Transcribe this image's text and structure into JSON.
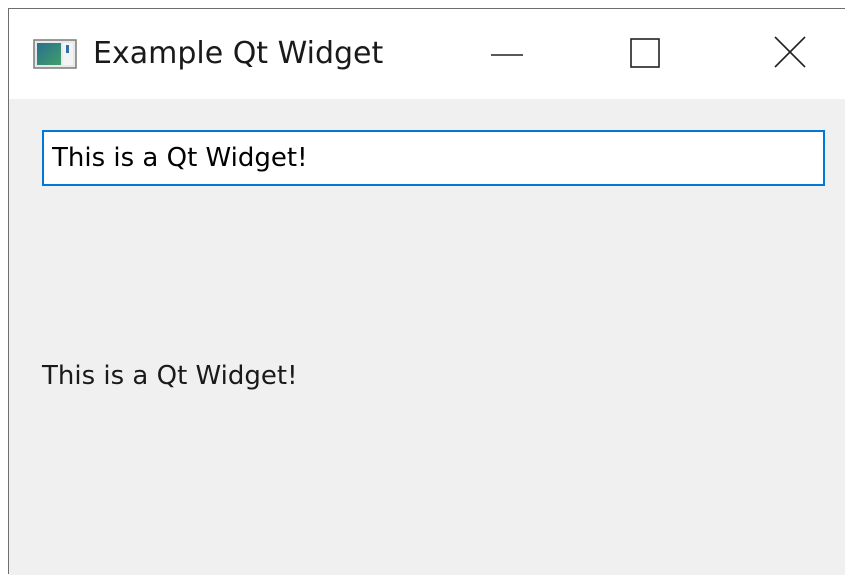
{
  "window": {
    "title": "Example Qt Widget",
    "app_icon": "qt-window-icon",
    "controls": {
      "minimize_icon": "minimize-icon",
      "maximize_icon": "maximize-icon",
      "close_icon": "close-icon"
    }
  },
  "content": {
    "line_edit": {
      "value": "This is a Qt Widget!",
      "focused": true
    },
    "label": {
      "text": "This is a Qt Widget!"
    }
  },
  "colors": {
    "focus_border": "#0078d7",
    "window_background": "#f0f0f0",
    "titlebar_background": "#ffffff"
  }
}
